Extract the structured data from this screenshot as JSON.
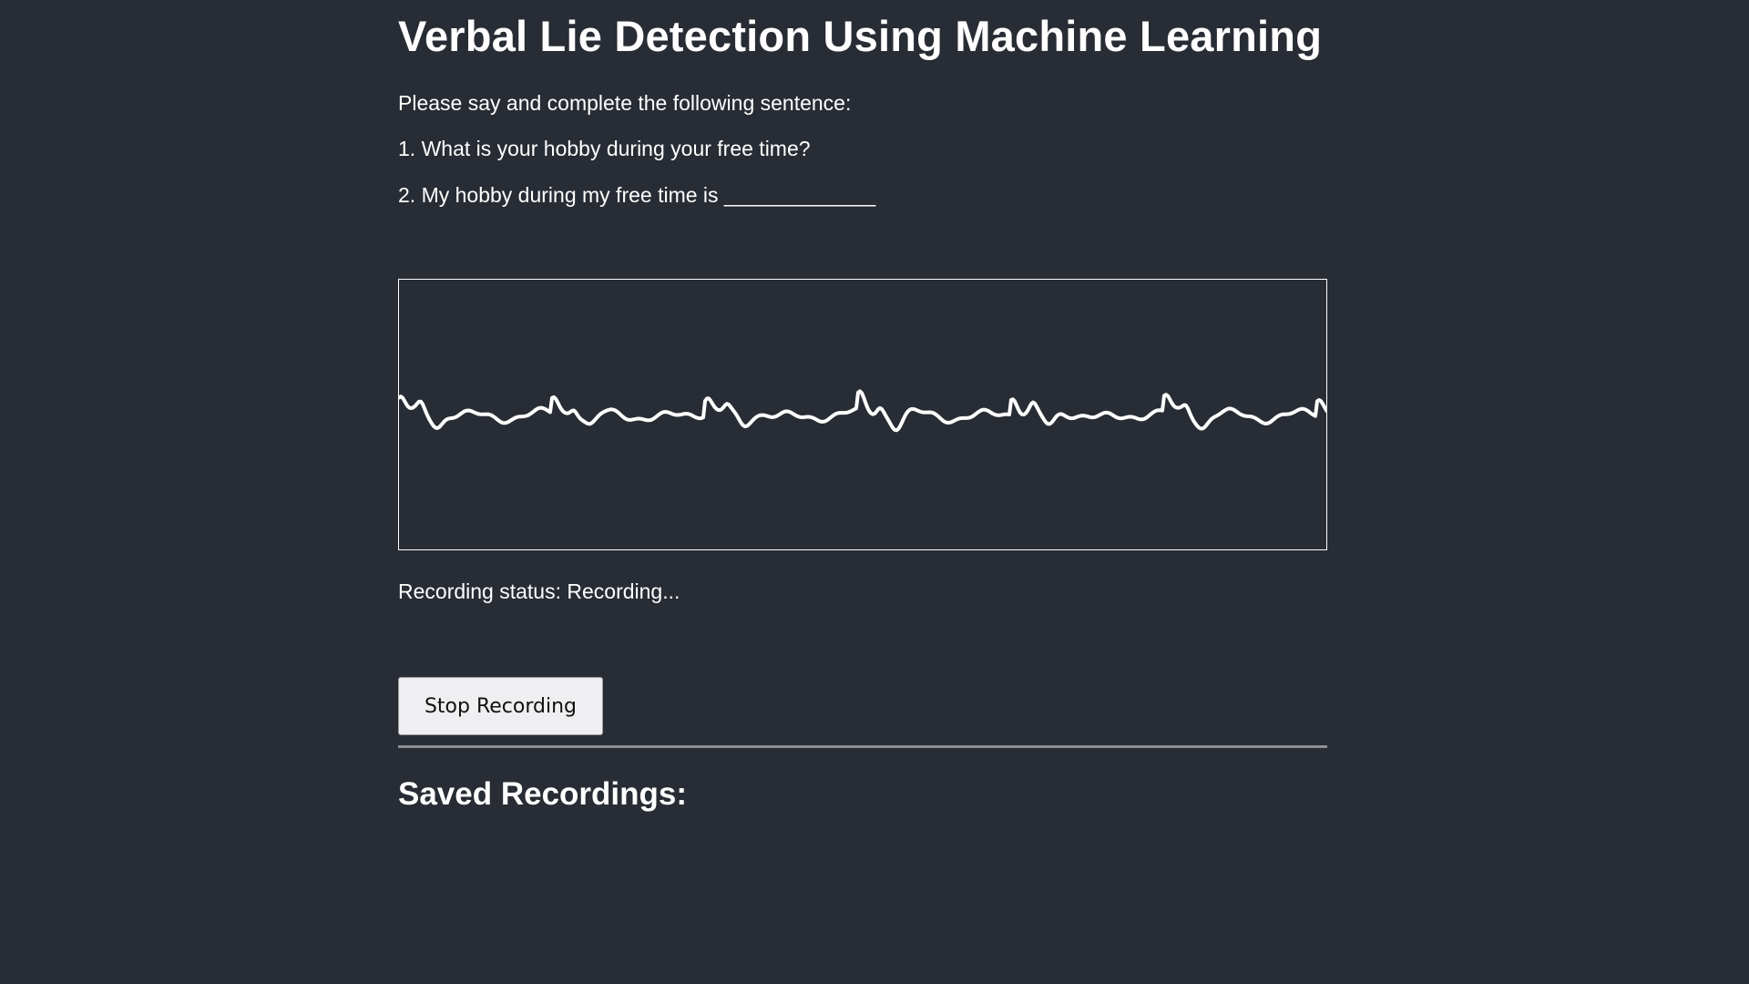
{
  "title": "Verbal Lie Detection Using Machine Learning",
  "instructions": {
    "prompt": "Please say and complete the following sentence:",
    "question_1": "1. What is your hobby during your free time?",
    "question_2": "2. My hobby during my free time is _____________"
  },
  "status": {
    "text": "Recording status: Recording..."
  },
  "controls": {
    "stop_label": "Stop Recording"
  },
  "saved_recordings": {
    "heading": "Saved Recordings:",
    "items": []
  },
  "colors": {
    "background": "#282c34",
    "text": "#ffffff",
    "waveform": "#ffffff"
  }
}
